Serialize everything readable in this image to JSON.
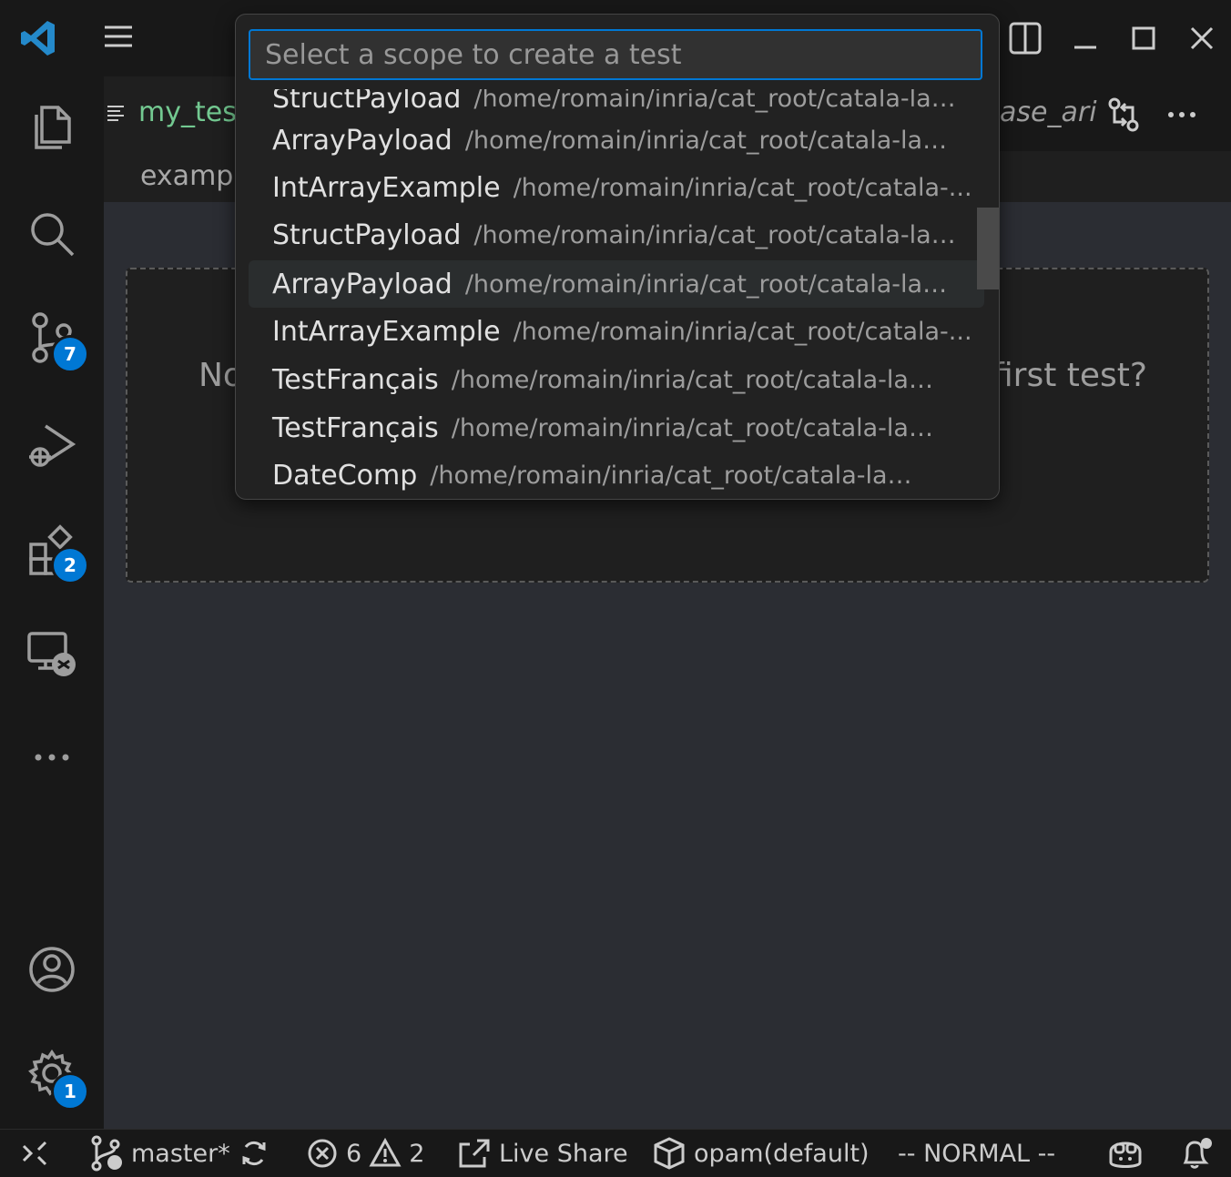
{
  "titlebar": {
    "right_tab_fragment": "ase_ari"
  },
  "editor": {
    "tab_label": "my_test",
    "breadcrumb": "exampl",
    "placeholder_left": "No",
    "placeholder_right": "first test?"
  },
  "quickpick": {
    "placeholder": "Select a scope to create a test",
    "items": [
      {
        "label": "StructPayload",
        "path": "/home/romain/inria/cat_root/catala-lan..."
      },
      {
        "label": "ArrayPayload",
        "path": "/home/romain/inria/cat_root/catala-lan..."
      },
      {
        "label": "IntArrayExample",
        "path": "/home/romain/inria/cat_root/catala-..."
      },
      {
        "label": "StructPayload",
        "path": "/home/romain/inria/cat_root/catala-lan..."
      },
      {
        "label": "ArrayPayload",
        "path": "/home/romain/inria/cat_root/catala-lan..."
      },
      {
        "label": "IntArrayExample",
        "path": "/home/romain/inria/cat_root/catala-..."
      },
      {
        "label": "TestFrançais",
        "path": "/home/romain/inria/cat_root/catala-lang..."
      },
      {
        "label": "TestFrançais",
        "path": "/home/romain/inria/cat_root/catala-lang..."
      },
      {
        "label": "DateComp",
        "path": "/home/romain/inria/cat_root/catala-langua..."
      }
    ]
  },
  "activity": {
    "source_control_badge": "7",
    "extensions_badge": "2",
    "settings_badge": "1"
  },
  "statusbar": {
    "branch": "master*",
    "errors": "6",
    "warnings": "2",
    "live_share": "Live Share",
    "opam": "opam(default)",
    "mode": "-- NORMAL --"
  },
  "colors": {
    "accent": "#0078d4",
    "background": "#1f1f1f",
    "sidebar": "#181818"
  }
}
